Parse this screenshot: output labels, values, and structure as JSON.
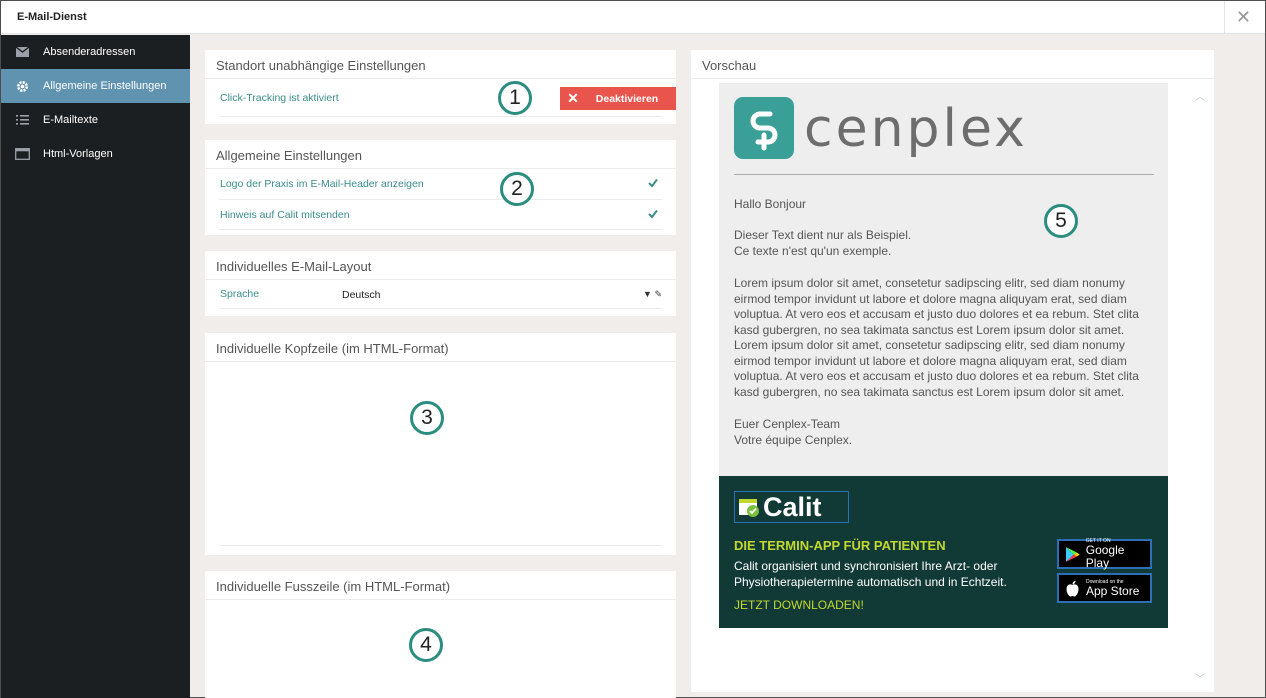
{
  "window": {
    "title": "E-Mail-Dienst",
    "close_icon": "close-icon"
  },
  "sidebar": {
    "items": [
      {
        "label": "Absenderadressen",
        "icon": "envelope-icon",
        "active": false
      },
      {
        "label": "Allgemeine Einstellungen",
        "icon": "gear-icon",
        "active": true
      },
      {
        "label": "E-Mailtexte",
        "icon": "list-icon",
        "active": false
      },
      {
        "label": "Html-Vorlagen",
        "icon": "window-icon",
        "active": false
      }
    ]
  },
  "panels": {
    "location": {
      "title": "Standort unabhängige Einstellungen",
      "tracking_label": "Click-Tracking ist aktiviert",
      "deactivate_label": "Deaktivieren"
    },
    "general": {
      "title": "Allgemeine Einstellungen",
      "options": [
        {
          "label": "Logo der Praxis im E-Mail-Header anzeigen",
          "checked": true
        },
        {
          "label": "Hinweis auf Calit mitsenden",
          "checked": true
        }
      ]
    },
    "layout": {
      "title": "Individuelles E-Mail-Layout",
      "language_label": "Sprache",
      "language_value": "Deutsch"
    },
    "header_html": {
      "title": "Individuelle Kopfzeile (im HTML-Format)",
      "content": ""
    },
    "footer_html": {
      "title": "Individuelle Fusszeile (im HTML-Format)",
      "content": ""
    }
  },
  "markers": [
    "1",
    "2",
    "3",
    "4",
    "5"
  ],
  "preview": {
    "title": "Vorschau",
    "logo_text": "cenplex",
    "greeting": "Hallo Bonjour",
    "sample_de": "Dieser Text dient nur als Beispiel.",
    "sample_fr": "Ce texte n'est qu'un exemple.",
    "lorem": "Lorem ipsum dolor sit amet, consetetur sadipscing elitr, sed diam nonumy eirmod tempor invidunt ut labore et dolore magna aliquyam erat, sed diam voluptua. At vero eos et accusam et justo duo dolores et ea rebum. Stet clita kasd gubergren, no sea takimata sanctus est Lorem ipsum dolor sit amet. Lorem ipsum dolor sit amet, consetetur sadipscing elitr, sed diam nonumy eirmod tempor invidunt ut labore et dolore magna aliquyam erat, sed diam voluptua. At vero eos et accusam et justo duo dolores et ea rebum. Stet clita kasd gubergren, no sea takimata sanctus est Lorem ipsum dolor sit amet.",
    "sign_de": "Euer Cenplex-Team",
    "sign_fr": "Votre équipe Cenplex.",
    "ad": {
      "brand": "Calit",
      "headline": "DIE TERMIN-APP FÜR PATIENTEN",
      "body": "Calit organisiert und synchronisiert Ihre Arzt- oder Physiotherapietermine automatisch und in Echtzeit.",
      "cta": "JETZT DOWNLOADEN!",
      "google_small": "GET IT ON",
      "google_big": "Google Play",
      "apple_small": "Download on the",
      "apple_big": "App Store"
    }
  },
  "colors": {
    "sidebar": "#1c1f22",
    "active": "#5f93b0",
    "accent": "#3a8d8b",
    "danger": "#e9544c",
    "marker": "#2a8d80",
    "ad_bg": "#113a36",
    "ad_accent": "#c3d82f"
  }
}
